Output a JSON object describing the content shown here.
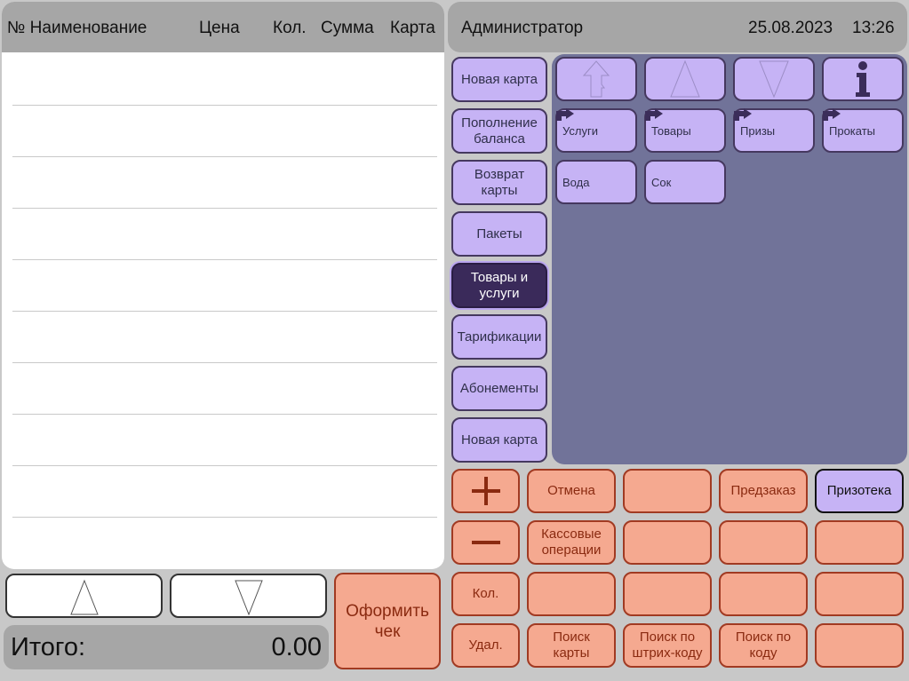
{
  "receipt": {
    "columns": {
      "name": "№ Наименование",
      "price": "Цена",
      "qty": "Кол.",
      "sum": "Сумма",
      "card": "Карта"
    }
  },
  "header": {
    "user": "Администратор",
    "date": "25.08.2023",
    "time": "13:26"
  },
  "categories": [
    "Новая карта",
    "Пополнение баланса",
    "Возврат карты",
    "Пакеты",
    "Товары и услуги",
    "Тарификации",
    "Абонементы",
    "Новая карта"
  ],
  "products": {
    "folders": [
      "Услуги",
      "Товары",
      "Призы",
      "Прокаты"
    ],
    "items": [
      "Вода",
      "Сок"
    ]
  },
  "actions": {
    "plus": "+",
    "minus": "−",
    "cancel": "Отмена",
    "preorder": "Предзаказ",
    "prize_library": "Призотека",
    "cash_ops": "Кассовые операции",
    "qty": "Кол.",
    "delete": "Удал.",
    "search_card": "Поиск карты",
    "search_barcode": "Поиск по штрих-коду",
    "search_code": "Поиск по коду",
    "checkout": "Оформить чек"
  },
  "total": {
    "label": "Итого:",
    "value": "0.00"
  },
  "colors": {
    "lilac": "#c6b3f5",
    "active": "#3a2a5a",
    "panel": "#717399",
    "orange": "#f5a990"
  }
}
